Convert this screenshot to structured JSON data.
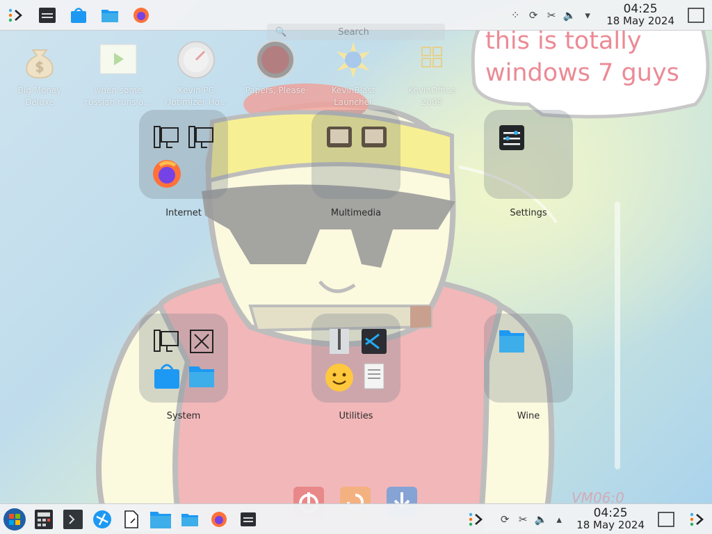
{
  "top_panel": {
    "launchers": [
      "app-launcher-icon",
      "system-monitor-icon",
      "discover-icon",
      "file-manager-icon",
      "firefox-icon"
    ],
    "clock_time": "04:25",
    "clock_date": "18 May 2024"
  },
  "bottom_panel": {
    "launchers": [
      "start-orb-icon",
      "calculator-icon",
      "terminal-icon",
      "browser-icon",
      "document-icon",
      "file-manager-icon",
      "folder-icon",
      "firefox-icon",
      "system-monitor-icon"
    ],
    "clock_time": "04:25",
    "clock_date": "18 May 2024"
  },
  "desktop_icons": [
    {
      "label": "Big Money Deluxe"
    },
    {
      "label": "when some russian runs a..."
    },
    {
      "label": "Kevin PC Optimizer Ho..."
    },
    {
      "label": "Papers, Please"
    },
    {
      "label": "KevinBlast Launcher"
    },
    {
      "label": "KevinOffice 2009"
    }
  ],
  "search": {
    "label": "Search"
  },
  "bubble": {
    "text": "this is totally windows 7 guys"
  },
  "groups": [
    {
      "label": "Internet"
    },
    {
      "label": "Multimedia"
    },
    {
      "label": "Settings"
    },
    {
      "label": "System"
    },
    {
      "label": "Utilities"
    },
    {
      "label": "Wine"
    }
  ],
  "watermark": "VM06:0"
}
